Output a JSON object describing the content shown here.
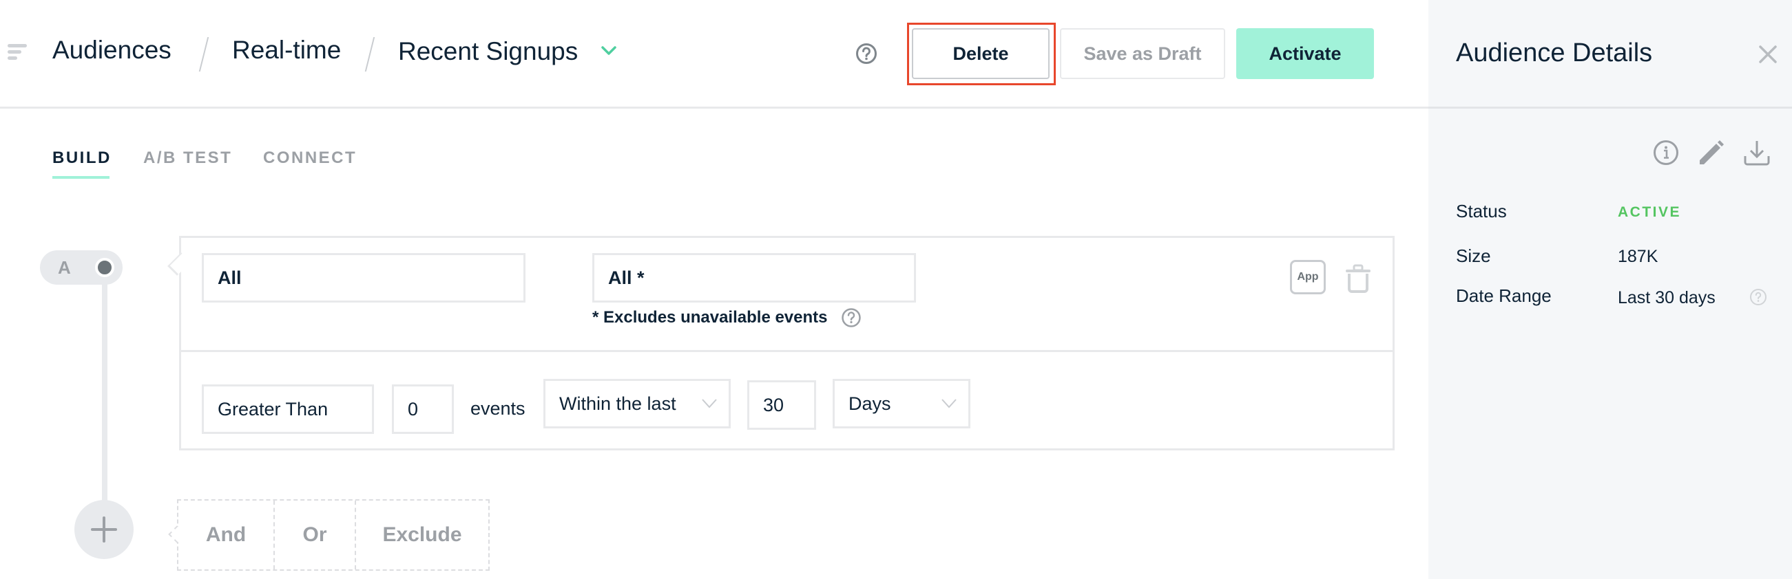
{
  "header": {
    "menu_icon": "hamburger-menu-icon",
    "breadcrumbs": [
      {
        "label": "Audiences"
      },
      {
        "label": "Real-time"
      },
      {
        "label": "Recent Signups"
      }
    ],
    "current_dropdown_icon": "chevron-down-icon",
    "help_icon": "question-circle-icon",
    "buttons": {
      "delete": "Delete",
      "save_draft": "Save as Draft",
      "activate": "Activate"
    }
  },
  "tabs": [
    {
      "label": "BUILD",
      "active": true
    },
    {
      "label": "A/B TEST",
      "active": false
    },
    {
      "label": "CONNECT",
      "active": false
    }
  ],
  "builder": {
    "group_label": "A",
    "condition": {
      "who_value": "All",
      "event_value": "All *",
      "event_note": "* Excludes unavailable events",
      "app_badge": "App",
      "comparator": "Greater Than",
      "count": "0",
      "count_unit": "events",
      "timeframe": "Within the last",
      "timeframe_value": "30",
      "timeframe_unit": "Days"
    },
    "logic_options": [
      "And",
      "Or",
      "Exclude"
    ]
  },
  "panel": {
    "title": "Audience Details",
    "details": [
      {
        "label": "Status",
        "value": "ACTIVE"
      },
      {
        "label": "Size",
        "value": "187K"
      },
      {
        "label": "Date Range",
        "value": "Last 30 days"
      }
    ]
  },
  "colors": {
    "accent": "#a1f2d9",
    "text_primary": "#0f2336",
    "text_muted": "#9ca0a5",
    "status_active": "#54c561",
    "highlight": "#e8472c",
    "panel_bg": "#f5f7f9",
    "border": "#e8e9eb"
  }
}
